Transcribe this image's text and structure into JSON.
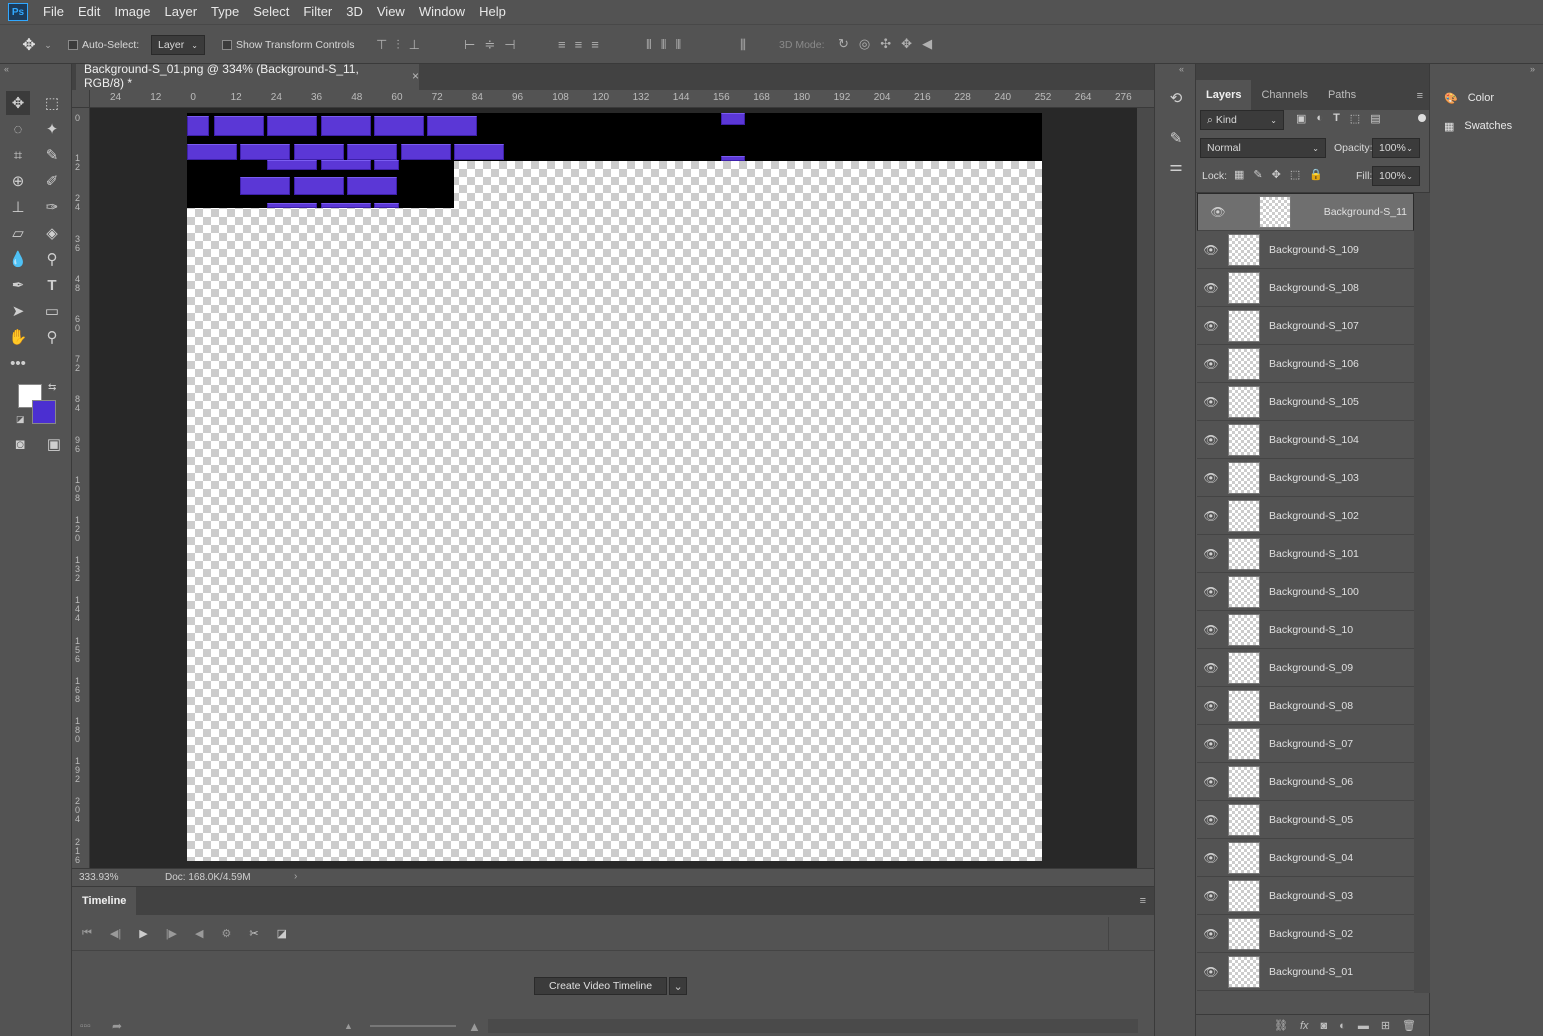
{
  "app": {
    "logo": "Ps"
  },
  "menu": [
    "File",
    "Edit",
    "Image",
    "Layer",
    "Type",
    "Select",
    "Filter",
    "3D",
    "View",
    "Window",
    "Help"
  ],
  "options": {
    "auto_select_label": "Auto-Select:",
    "auto_select_value": "Layer",
    "transform_label": "Show Transform Controls",
    "mode_3d_label": "3D Mode:"
  },
  "document": {
    "tab_title": "Background-S_01.png @ 334% (Background-S_11, RGB/8) *",
    "close_glyph": "×"
  },
  "ruler_top": [
    "24",
    "12",
    "0",
    "12",
    "24",
    "36",
    "48",
    "60",
    "72",
    "84",
    "96",
    "108",
    "120",
    "132",
    "144",
    "156",
    "168",
    "180",
    "192",
    "204",
    "216",
    "228",
    "240",
    "252",
    "264",
    "276"
  ],
  "ruler_left": [
    "0",
    "1 2",
    "2 4",
    "3 6",
    "4 8",
    "6 0",
    "7 2",
    "8 4",
    "9 6",
    "1 0 8",
    "1 2 0",
    "1 3 2",
    "1 4 4",
    "1 5 6",
    "1 6 8",
    "1 8 0",
    "1 9 2",
    "2 0 4",
    "2 1 6"
  ],
  "status": {
    "zoom": "333.93%",
    "doc": "Doc: 168.0K/4.59M",
    "arrow": "›"
  },
  "timeline": {
    "tab": "Timeline",
    "create_button": "Create Video Timeline"
  },
  "panels": {
    "tabs": [
      "Layers",
      "Channels",
      "Paths"
    ],
    "filter_kind": "Kind",
    "blend_mode": "Normal",
    "opacity_label": "Opacity:",
    "opacity_value": "100%",
    "lock_label": "Lock:",
    "fill_label": "Fill:",
    "fill_value": "100%"
  },
  "layers": [
    "Background-S_11",
    "Background-S_109",
    "Background-S_108",
    "Background-S_107",
    "Background-S_106",
    "Background-S_105",
    "Background-S_104",
    "Background-S_103",
    "Background-S_102",
    "Background-S_101",
    "Background-S_100",
    "Background-S_10",
    "Background-S_09",
    "Background-S_08",
    "Background-S_07",
    "Background-S_06",
    "Background-S_05",
    "Background-S_04",
    "Background-S_03",
    "Background-S_02",
    "Background-S_01"
  ],
  "selected_layer": "Background-S_11",
  "side_panels": {
    "color": "Color",
    "swatches": "Swatches"
  },
  "colors": {
    "foreground": "#ffffff",
    "background": "#4b2fd1",
    "brick": "#5b37d6"
  }
}
